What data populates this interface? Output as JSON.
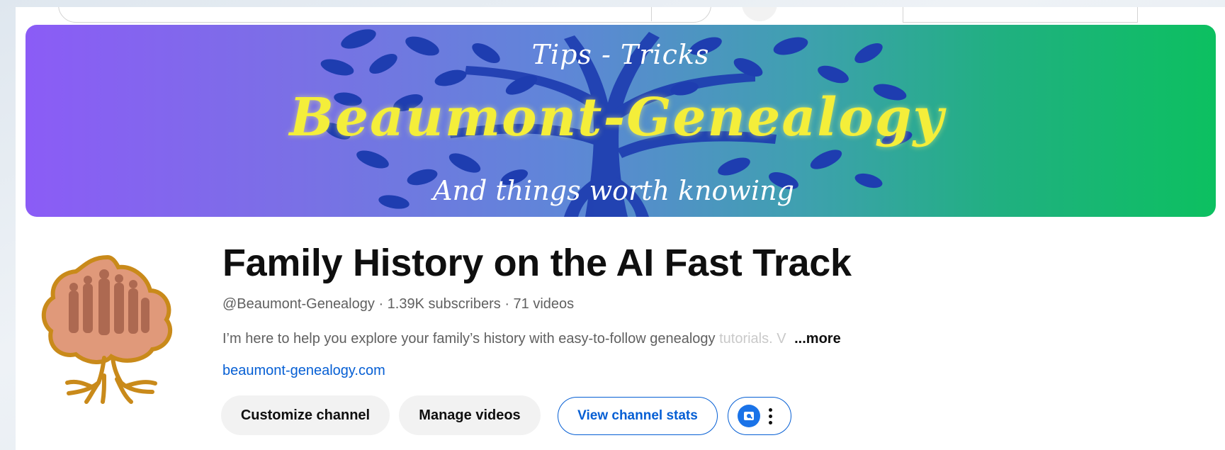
{
  "banner": {
    "tips": "Tips - Tricks",
    "brand": "Beaumont-Genealogy",
    "tagline": "And things worth knowing"
  },
  "channel": {
    "title": "Family History on the AI Fast Track",
    "handle": "@Beaumont-Genealogy",
    "subscribers": "1.39K subscribers",
    "videos": "71 videos",
    "separator": "·",
    "description": "I’m here to help you explore your family’s history with easy-to-follow genealogy tutorials.",
    "description_fade": "tutorials. V",
    "more_label": "...more",
    "link": "beaumont-genealogy.com"
  },
  "actions": {
    "customize": "Customize channel",
    "manage": "Manage videos",
    "stats": "View channel stats"
  },
  "colors": {
    "accent": "#065fd4",
    "banner_left": "#8b5cf6",
    "banner_right": "#0cc060",
    "brand_text": "#f4ee3a"
  },
  "icons": [
    "search-icon",
    "mic-icon",
    "channel-stats-icon",
    "more-vert-icon"
  ]
}
